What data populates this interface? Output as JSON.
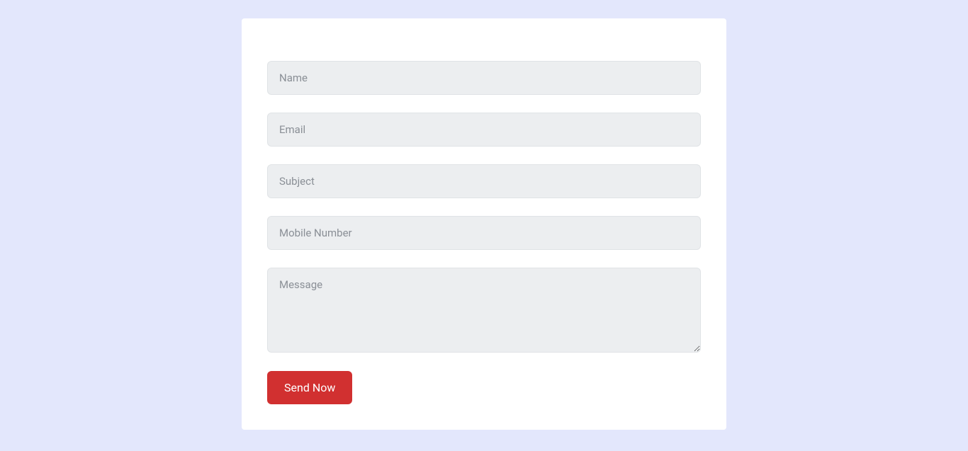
{
  "form": {
    "fields": {
      "name": {
        "placeholder": "Name",
        "value": ""
      },
      "email": {
        "placeholder": "Email",
        "value": ""
      },
      "subject": {
        "placeholder": "Subject",
        "value": ""
      },
      "mobile": {
        "placeholder": "Mobile Number",
        "value": ""
      },
      "message": {
        "placeholder": "Message",
        "value": ""
      }
    },
    "submit_label": "Send Now"
  },
  "colors": {
    "background": "#e3e7fc",
    "card_bg": "#ffffff",
    "input_bg": "#eceef0",
    "input_border": "#e0e3e6",
    "placeholder": "#8a8f96",
    "button": "#d13030",
    "button_text": "#ffffff"
  }
}
